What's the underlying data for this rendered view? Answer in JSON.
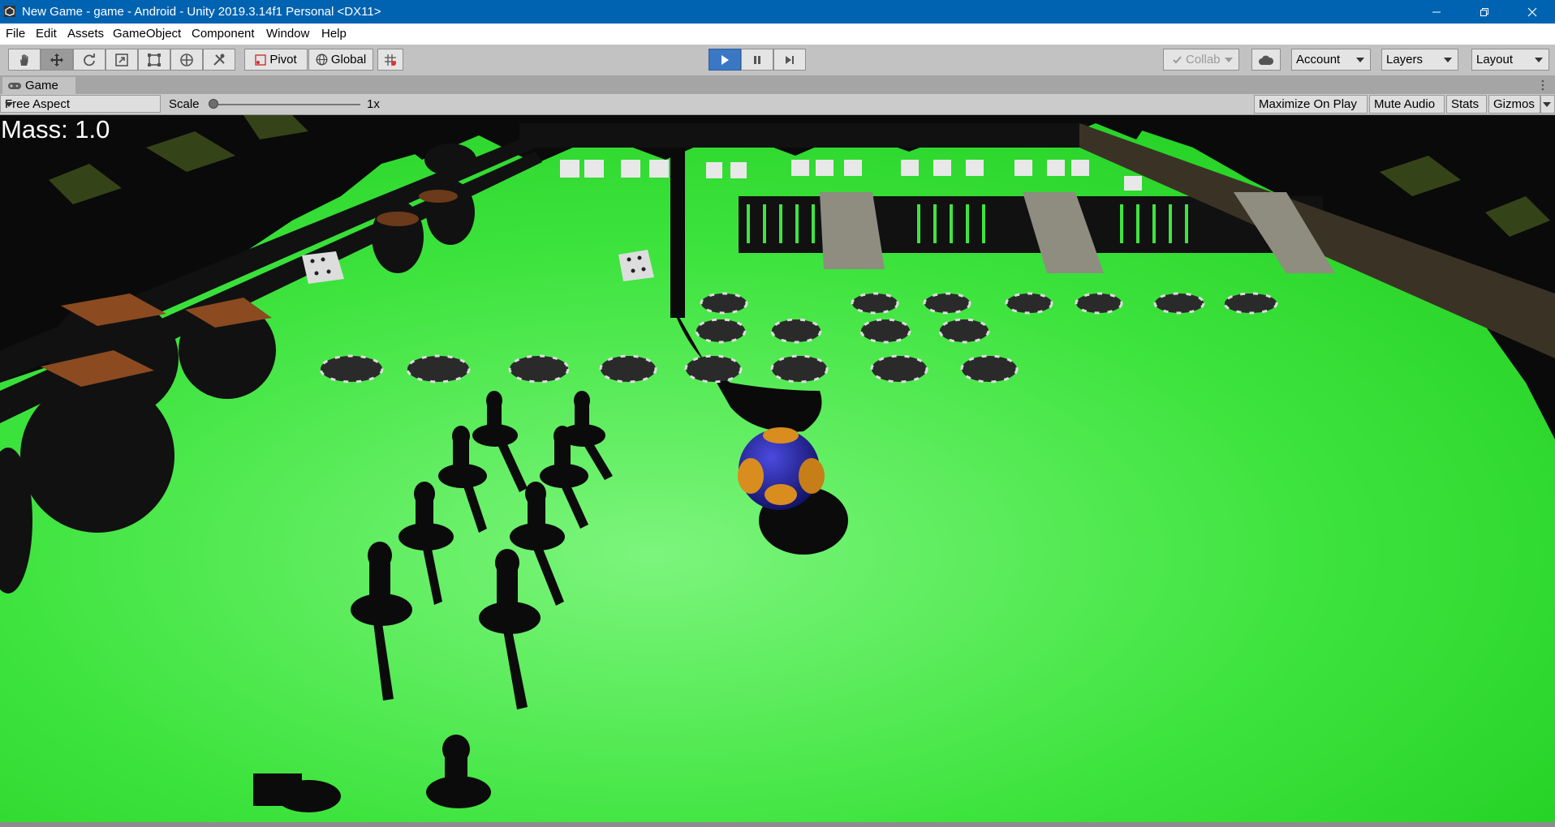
{
  "window": {
    "title": "New Game - game - Android - Unity 2019.3.14f1 Personal <DX11>",
    "controls": [
      "minimize-icon",
      "maximize-icon",
      "close-icon"
    ]
  },
  "menu": [
    "File",
    "Edit",
    "Assets",
    "GameObject",
    "Component",
    "Window",
    "Help"
  ],
  "toolbar": {
    "tools": [
      "hand-tool-icon",
      "move-tool-icon",
      "rotate-tool-icon",
      "scale-tool-icon",
      "rect-tool-icon",
      "transform-tool-icon",
      "custom-tool-icon"
    ],
    "pivot_label": "Pivot",
    "global_label": "Global",
    "collab_label": "Collab",
    "account_label": "Account",
    "layers_label": "Layers",
    "layout_label": "Layout"
  },
  "game_tab": {
    "label": "Game"
  },
  "game_bar": {
    "aspect": "Free Aspect",
    "scale_label": "Scale",
    "scale_value": "1x",
    "maximize_on_play": "Maximize On Play",
    "mute_audio": "Mute Audio",
    "stats": "Stats",
    "gizmos": "Gizmos"
  },
  "hud": {
    "mass_text": "Mass: 1.0"
  },
  "colors": {
    "titlebar": "#0063b1",
    "ground": "#3ee63e",
    "play_active": "#3a78c4"
  }
}
